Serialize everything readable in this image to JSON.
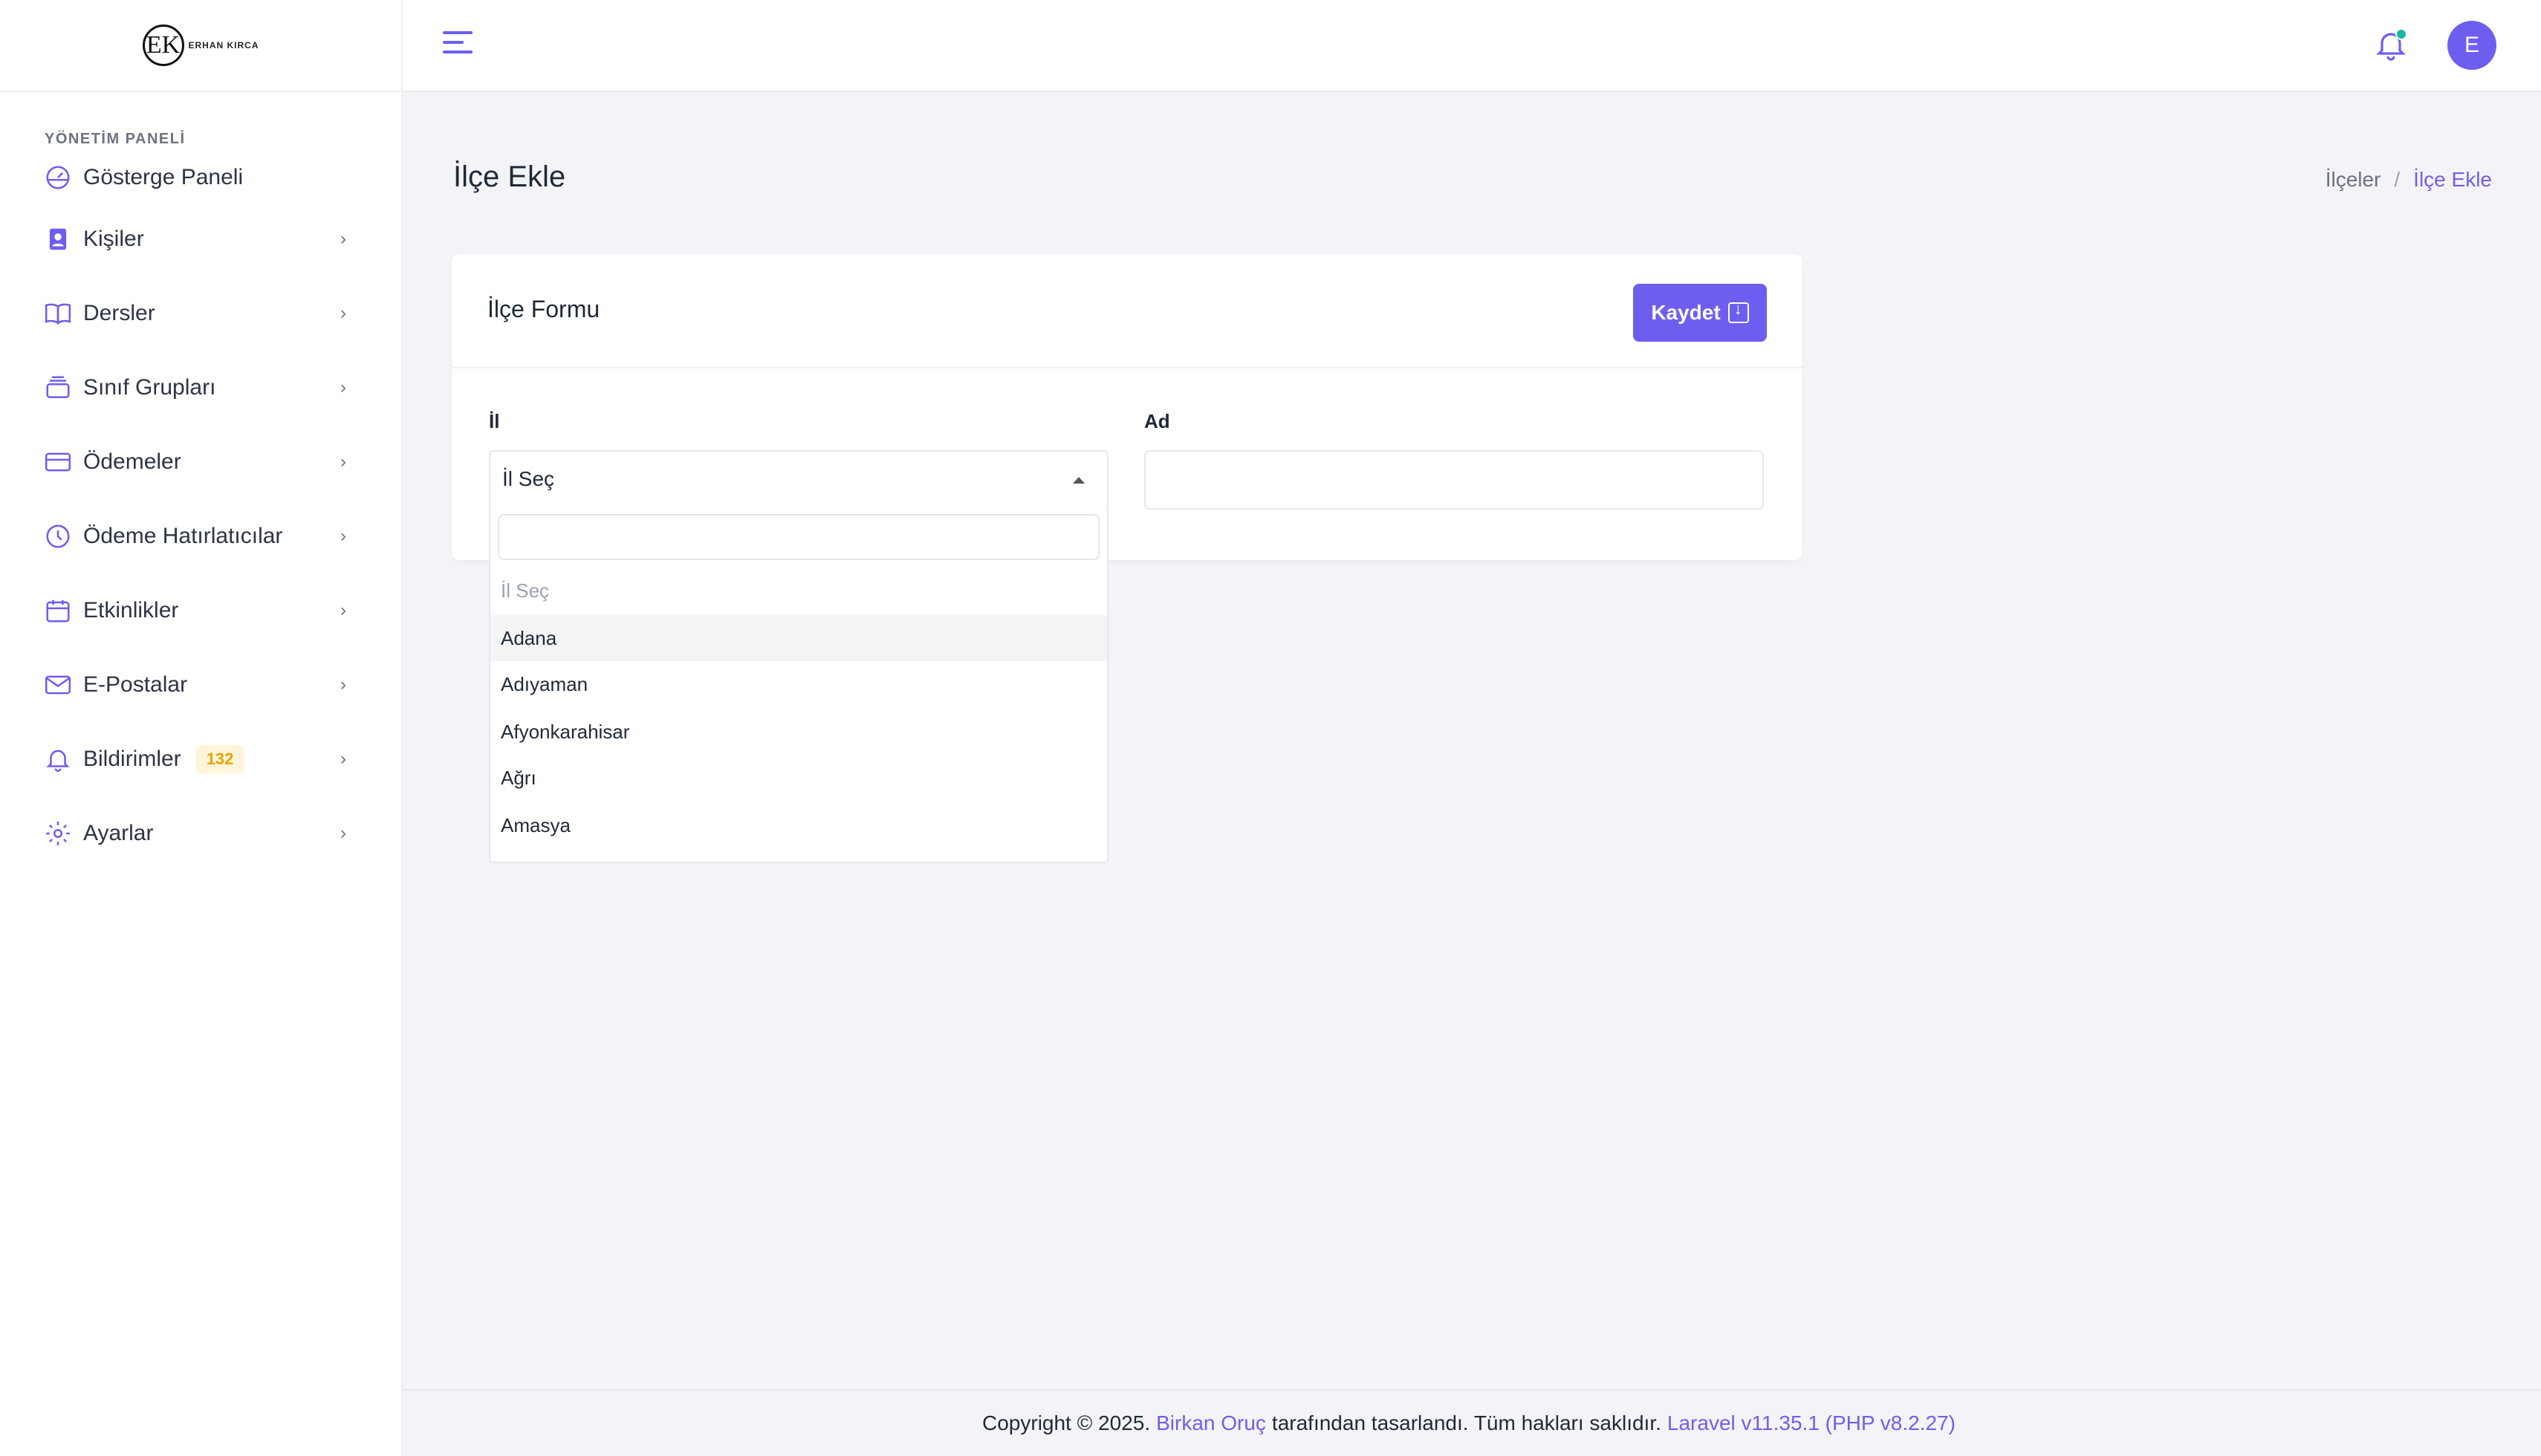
{
  "logo": {
    "text": "ERHAN KIRCA"
  },
  "sidebar": {
    "caption": "YÖNETİM PANELİ",
    "items": [
      {
        "label": "Gösterge Paneli",
        "icon": "dashboard-icon"
      },
      {
        "label": "Kişiler",
        "icon": "contact-icon"
      },
      {
        "label": "Dersler",
        "icon": "book-icon"
      },
      {
        "label": "Sınıf Grupları",
        "icon": "layers-icon"
      },
      {
        "label": "Ödemeler",
        "icon": "credit-card-icon"
      },
      {
        "label": "Ödeme Hatırlatıcılar",
        "icon": "clock-icon"
      },
      {
        "label": "Etkinlikler",
        "icon": "calendar-icon"
      },
      {
        "label": "E-Postalar",
        "icon": "mail-icon"
      },
      {
        "label": "Bildirimler",
        "icon": "bell-icon",
        "badge": "132"
      },
      {
        "label": "Ayarlar",
        "icon": "gear-icon"
      }
    ]
  },
  "topbar": {
    "avatar_initial": "E"
  },
  "page": {
    "title": "İlçe Ekle",
    "breadcrumb": {
      "parent": "İlçeler",
      "separator": "/",
      "current": "İlçe Ekle"
    }
  },
  "form": {
    "title": "İlçe Formu",
    "save_label": "Kaydet",
    "province_label": "İl",
    "province_selected": "İl Seç",
    "name_label": "Ad",
    "options": [
      "İl Seç",
      "Adana",
      "Adıyaman",
      "Afyonkarahisar",
      "Ağrı",
      "Amasya"
    ]
  },
  "footer": {
    "prefix": "Copyright © 2025.",
    "author": "Birkan Oruç",
    "middle": "tarafından tasarlandı. Tüm hakları saklıdır.",
    "version": "Laravel v11.35.1 (PHP v8.2.27)"
  },
  "colors": {
    "accent": "#6e5ef0",
    "badge_bg": "#fff5db",
    "badge_text": "#e9a400",
    "bell_dot": "#14b8a6"
  }
}
